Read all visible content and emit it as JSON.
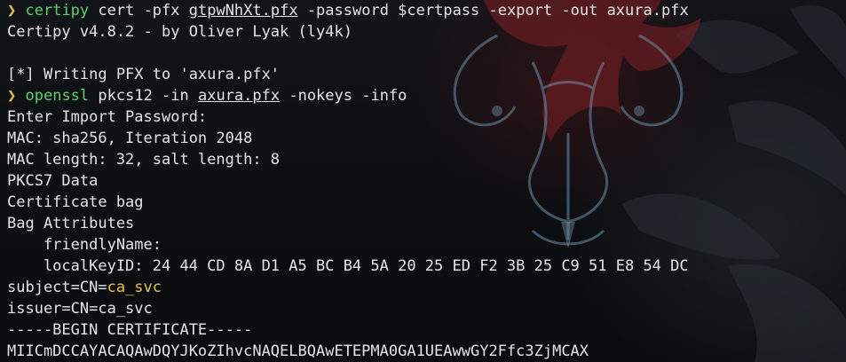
{
  "colors": {
    "prompt": "#e8c547",
    "command": "#5bd06b",
    "text": "#e6e6e6",
    "highlight": "#e8c547",
    "background": "#0b0d10"
  },
  "icons": {
    "prompt_symbol": "chevron-right-icon"
  },
  "lines": {
    "l1": {
      "prompt": "❯",
      "cmd": "certipy",
      "a": " cert -pfx ",
      "file": "gtpwNhXt.pfx",
      "b": " -password $certpass -export -out axura.pfx"
    },
    "l2": "Certipy v4.8.2 - by Oliver Lyak (ly4k)",
    "l3": "",
    "l4": "[*] Writing PFX to 'axura.pfx'",
    "l5": {
      "prompt": "❯",
      "cmd": "openssl",
      "a": " pkcs12 -in ",
      "file": "axura.pfx",
      "b": " -nokeys -info"
    },
    "l6": "Enter Import Password:",
    "l7": "MAC: sha256, Iteration 2048",
    "l8": "MAC length: 32, salt length: 8",
    "l9": "PKCS7 Data",
    "l10": "Certificate bag",
    "l11": "Bag Attributes",
    "l12": "    friendlyName:",
    "l13": "    localKeyID: 24 44 CD 8A D1 A5 BC B4 5A 20 25 ED F2 3B 25 C9 51 E8 54 DC",
    "l14": {
      "pre": "subject=CN=",
      "val": "ca_svc"
    },
    "l15": "issuer=CN=ca_svc",
    "l16": "-----BEGIN CERTIFICATE-----",
    "l17": "MIICmDCCAYACAQAwDQYJKoZIhvcNAQELBQAwETEPMA0GA1UEAwwGY2Ffc3ZjMCAX"
  }
}
